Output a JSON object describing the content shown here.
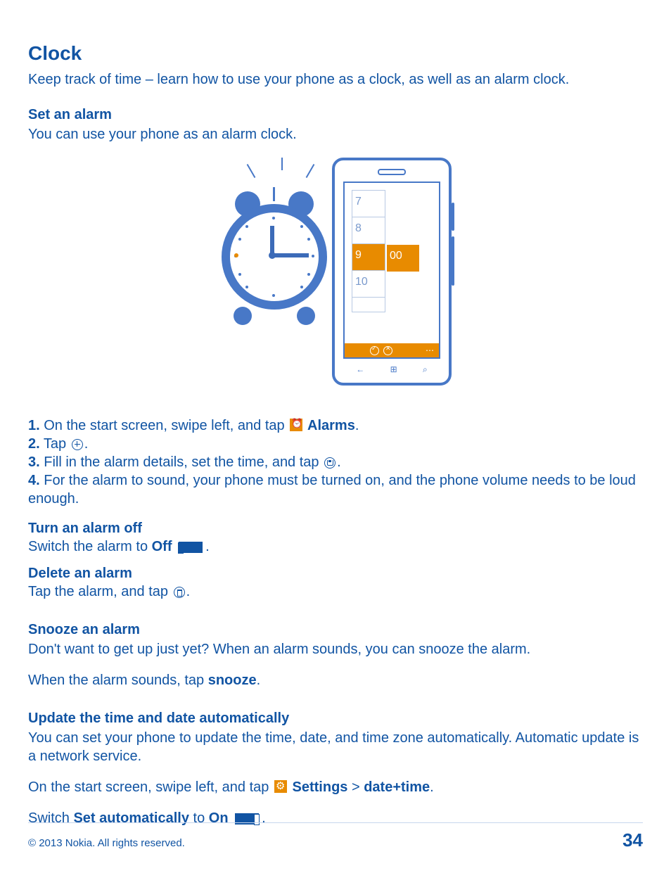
{
  "title": "Clock",
  "intro": "Keep track of time – learn how to use your phone as a clock, as well as an alarm clock.",
  "set_alarm": {
    "heading": "Set an alarm",
    "body": "You can use your phone as an alarm clock."
  },
  "steps": {
    "s1_pre": "1.",
    "s1_a": " On the start screen, swipe left, and tap ",
    "s1_b": " Alarms",
    "s1_c": ".",
    "s2_pre": "2.",
    "s2_a": " Tap ",
    "s2_b": ".",
    "s3_pre": "3.",
    "s3_a": " Fill in the alarm details, set the time, and tap ",
    "s3_b": ".",
    "s4_pre": "4.",
    "s4_a": " For the alarm to sound, your phone must be turned on, and the phone volume needs to be loud enough."
  },
  "turn_off": {
    "heading": "Turn an alarm off",
    "line_a": "Switch the alarm to ",
    "off": "Off",
    "line_b": " ",
    "line_c": "."
  },
  "delete": {
    "heading": "Delete an alarm",
    "line_a": "Tap the alarm, and tap ",
    "line_b": "."
  },
  "snooze": {
    "heading": "Snooze an alarm",
    "body1": "Don't want to get up just yet? When an alarm sounds, you can snooze the alarm.",
    "body2_a": "When the alarm sounds, tap ",
    "body2_b": "snooze",
    "body2_c": "."
  },
  "auto": {
    "heading": "Update the time and date automatically",
    "body1": "You can set your phone to update the time, date, and time zone automatically. Automatic update is a network service.",
    "body2_a": "On the start screen, swipe left, and tap ",
    "body2_b": " Settings",
    "body2_gt": " > ",
    "body2_c": "date+time",
    "body2_d": ".",
    "body3_a": "Switch ",
    "body3_b": "Set automatically",
    "body3_c": " to ",
    "body3_d": "On",
    "body3_e": " ",
    "body3_f": "."
  },
  "illus": {
    "picker_hours": [
      "7",
      "8",
      "9",
      "10"
    ],
    "picker_min": "00",
    "nav_back": "←",
    "nav_start": "⊞",
    "nav_search": "⌕"
  },
  "footer": {
    "copyright": "© 2013 Nokia. All rights reserved.",
    "page": "34"
  }
}
